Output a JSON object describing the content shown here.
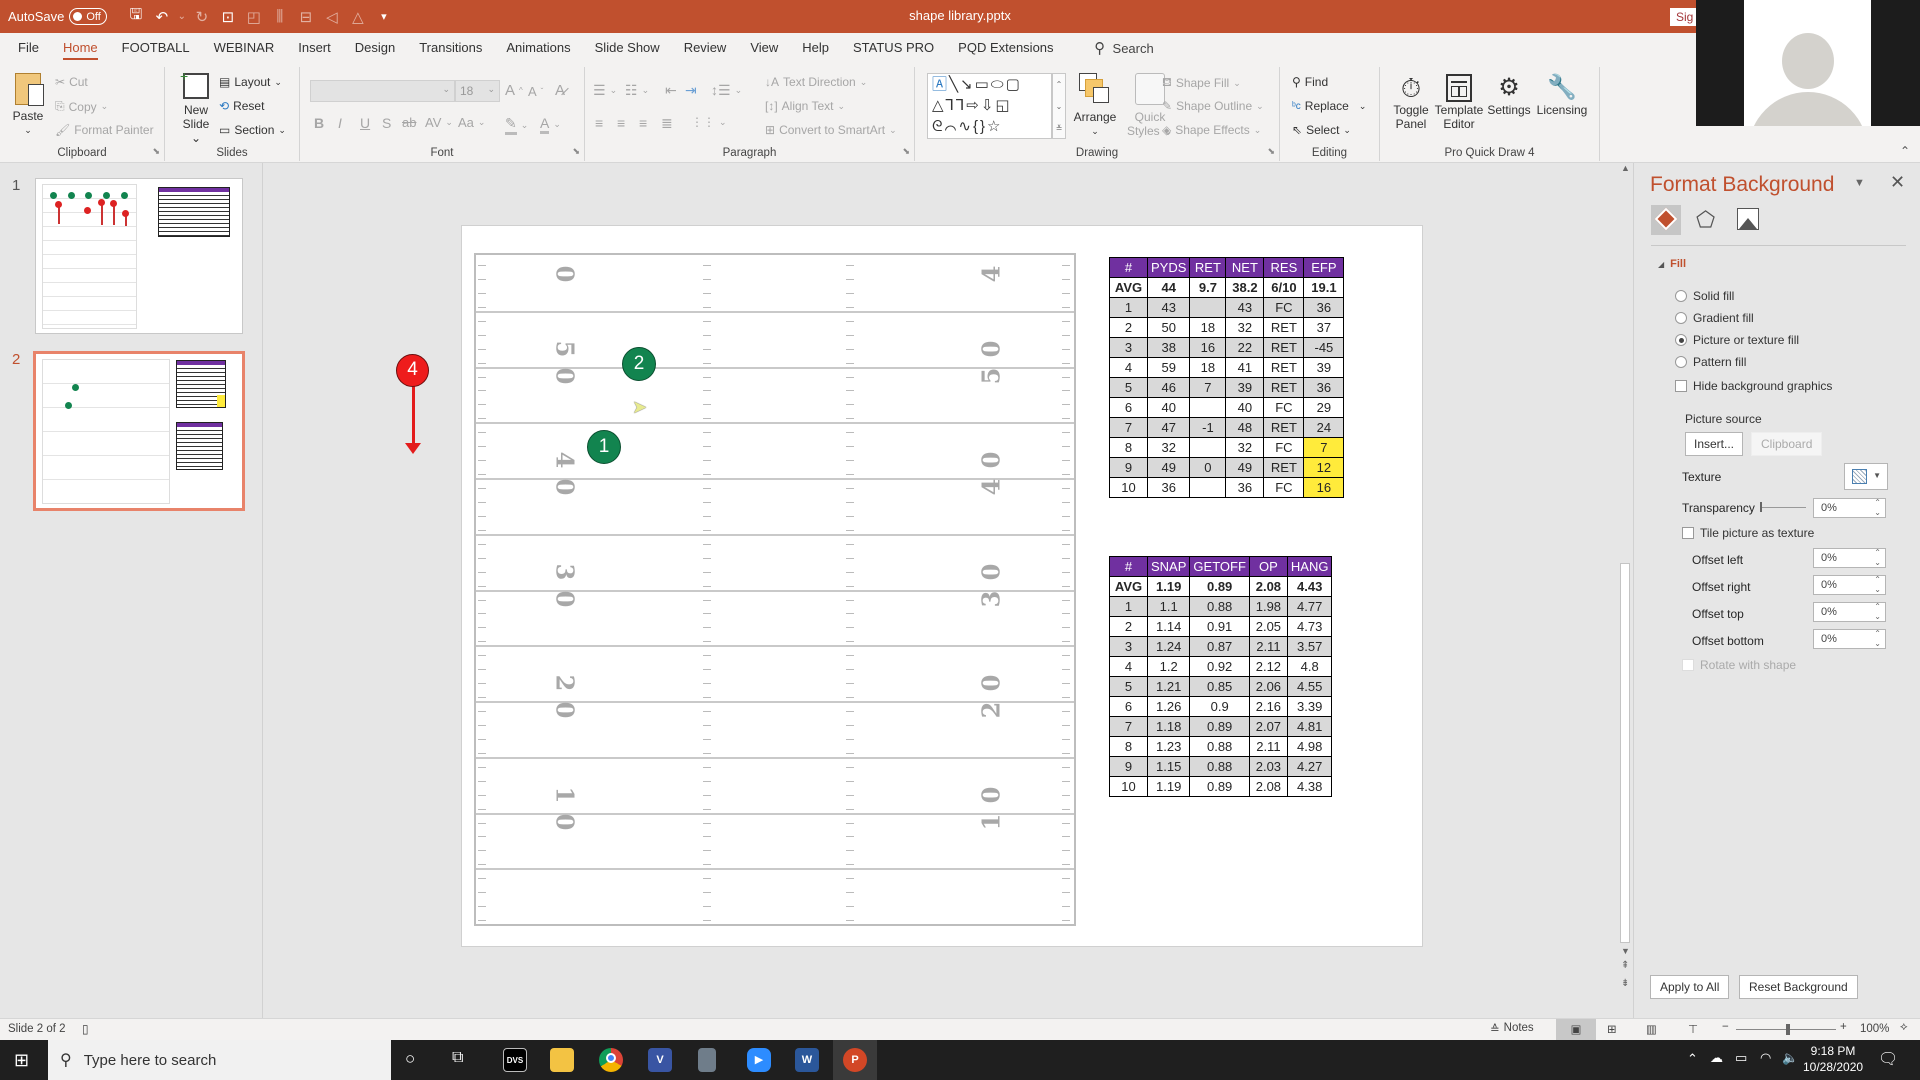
{
  "titlebar": {
    "autosave_label": "AutoSave",
    "autosave_state": "Off",
    "doc_title": "shape library.pptx",
    "signin_label": "Sig",
    "qat_icons": [
      "save-icon",
      "undo-icon",
      "redo-icon",
      "present-from-start-icon",
      "shape-icon",
      "distribute-icon",
      "align-icon",
      "flip-icon",
      "triangle-icon",
      "customize-qat-icon"
    ]
  },
  "tabs": [
    "File",
    "Home",
    "FOOTBALL",
    "WEBINAR",
    "Insert",
    "Design",
    "Transitions",
    "Animations",
    "Slide Show",
    "Review",
    "View",
    "Help",
    "STATUS PRO",
    "PQD Extensions"
  ],
  "active_tab": "Home",
  "search_label": "Search",
  "ribbon": {
    "clipboard": {
      "label": "Clipboard",
      "paste": "Paste",
      "cut": "Cut",
      "copy": "Copy",
      "format_painter": "Format Painter"
    },
    "slides": {
      "label": "Slides",
      "new_slide_1": "New",
      "new_slide_2": "Slide",
      "layout": "Layout",
      "reset": "Reset",
      "section": "Section"
    },
    "font": {
      "label": "Font",
      "font_name": "",
      "font_size": "18",
      "bold": "B",
      "italic": "I",
      "underline": "U",
      "shadow": "S",
      "strike": "ab",
      "spacing": "AV",
      "case": "Aa",
      "grow": "A",
      "shrink": "A"
    },
    "paragraph": {
      "label": "Paragraph",
      "text_direction": "Text Direction",
      "align_text": "Align Text",
      "convert_smartart": "Convert to SmartArt"
    },
    "drawing": {
      "label": "Drawing",
      "arrange": "Arrange",
      "quick_styles_1": "Quick",
      "quick_styles_2": "Styles",
      "shape_fill": "Shape Fill",
      "shape_outline": "Shape Outline",
      "shape_effects": "Shape Effects"
    },
    "editing": {
      "label": "Editing",
      "find": "Find",
      "replace": "Replace",
      "select": "Select"
    },
    "pqd": {
      "label": "Pro Quick Draw 4",
      "toggle_1": "Toggle",
      "toggle_2": "Panel",
      "template_1": "Template",
      "template_2": "Editor",
      "settings": "Settings",
      "licensing": "Licensing"
    }
  },
  "thumbnails": [
    {
      "number": "1",
      "selected": false
    },
    {
      "number": "2",
      "selected": true
    }
  ],
  "slide": {
    "yard_numbers_left": [
      "0",
      "50",
      "40",
      "30",
      "20",
      "10"
    ],
    "players": [
      {
        "label": "2",
        "team": "offense"
      },
      {
        "label": "1",
        "team": "offense"
      }
    ],
    "defender": {
      "label": "4"
    },
    "punt_table": {
      "headers": [
        "#",
        "PYDS",
        "RET",
        "NET",
        "RES",
        "EFP"
      ],
      "avg": [
        "AVG",
        "44",
        "9.7",
        "38.2",
        "6/10",
        "19.1"
      ],
      "rows": [
        [
          "1",
          "43",
          "",
          "43",
          "FC",
          "36"
        ],
        [
          "2",
          "50",
          "18",
          "32",
          "RET",
          "37"
        ],
        [
          "3",
          "38",
          "16",
          "22",
          "RET",
          "-45"
        ],
        [
          "4",
          "59",
          "18",
          "41",
          "RET",
          "39"
        ],
        [
          "5",
          "46",
          "7",
          "39",
          "RET",
          "36"
        ],
        [
          "6",
          "40",
          "",
          "40",
          "FC",
          "29"
        ],
        [
          "7",
          "47",
          "-1",
          "48",
          "RET",
          "24"
        ],
        [
          "8",
          "32",
          "",
          "32",
          "FC",
          "7"
        ],
        [
          "9",
          "49",
          "0",
          "49",
          "RET",
          "12"
        ],
        [
          "10",
          "36",
          "",
          "36",
          "FC",
          "16"
        ]
      ],
      "highlight_color": "#ffeb3b",
      "header_color": "#7030a0"
    },
    "timing_table": {
      "headers": [
        "#",
        "SNAP",
        "GETOFF",
        "OP",
        "HANG"
      ],
      "avg": [
        "AVG",
        "1.19",
        "0.89",
        "2.08",
        "4.43"
      ],
      "rows": [
        [
          "1",
          "1.1",
          "0.88",
          "1.98",
          "4.77"
        ],
        [
          "2",
          "1.14",
          "0.91",
          "2.05",
          "4.73"
        ],
        [
          "3",
          "1.24",
          "0.87",
          "2.11",
          "3.57"
        ],
        [
          "4",
          "1.2",
          "0.92",
          "2.12",
          "4.8"
        ],
        [
          "5",
          "1.21",
          "0.85",
          "2.06",
          "4.55"
        ],
        [
          "6",
          "1.26",
          "0.9",
          "2.16",
          "3.39"
        ],
        [
          "7",
          "1.18",
          "0.89",
          "2.07",
          "4.81"
        ],
        [
          "8",
          "1.23",
          "0.88",
          "2.11",
          "4.98"
        ],
        [
          "9",
          "1.15",
          "0.88",
          "2.03",
          "4.27"
        ],
        [
          "10",
          "1.19",
          "0.89",
          "2.08",
          "4.38"
        ]
      ]
    }
  },
  "format_pane": {
    "title": "Format Background",
    "section": "Fill",
    "options": [
      {
        "label": "Solid fill",
        "checked": false
      },
      {
        "label": "Gradient fill",
        "checked": false
      },
      {
        "label": "Picture or texture fill",
        "checked": true
      },
      {
        "label": "Pattern fill",
        "checked": false
      }
    ],
    "hide_bg_graphics": "Hide background graphics",
    "picture_source": "Picture source",
    "insert_btn": "Insert...",
    "clipboard_btn": "Clipboard",
    "texture": "Texture",
    "transparency": "Transparency",
    "transparency_value": "0%",
    "tile": "Tile picture as texture",
    "offsets": [
      {
        "label": "Offset left",
        "value": "0%"
      },
      {
        "label": "Offset right",
        "value": "0%"
      },
      {
        "label": "Offset top",
        "value": "0%"
      },
      {
        "label": "Offset bottom",
        "value": "0%"
      }
    ],
    "rotate": "Rotate with shape",
    "apply_all": "Apply to All",
    "reset_bg": "Reset Background"
  },
  "statusbar": {
    "slide_info": "Slide 2 of 2",
    "notes": "Notes",
    "zoom": "100%",
    "zoom_level_pct": 100
  },
  "taskbar": {
    "search_placeholder": "Type here to search",
    "time": "9:18 PM",
    "date": "10/28/2020",
    "apps": [
      "DVS",
      "File Explorer",
      "Chrome",
      "Visio",
      "Calculator",
      "Zoom",
      "Word",
      "PowerPoint"
    ]
  }
}
